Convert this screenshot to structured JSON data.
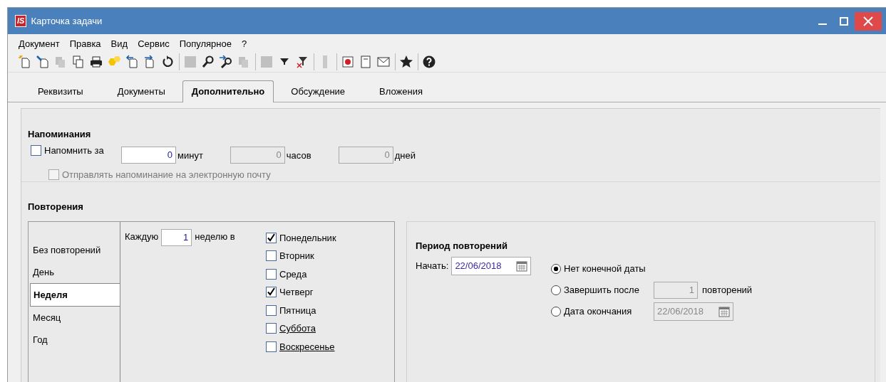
{
  "window": {
    "title": "Карточка задачи",
    "logo": "IS"
  },
  "menu": [
    "Документ",
    "Правка",
    "Вид",
    "Сервис",
    "Популярное",
    "?"
  ],
  "toolbar": [
    {
      "kind": "new",
      "disabled": false
    },
    {
      "kind": "edit",
      "disabled": false
    },
    {
      "kind": "copy",
      "disabled": true
    },
    {
      "kind": "duplicate",
      "disabled": false
    },
    {
      "kind": "print",
      "disabled": false
    },
    {
      "kind": "group",
      "disabled": false
    },
    {
      "kind": "import",
      "disabled": false
    },
    {
      "kind": "export",
      "disabled": false
    },
    {
      "kind": "refresh",
      "disabled": false
    },
    {
      "kind": "separator"
    },
    {
      "kind": "block",
      "disabled": true
    },
    {
      "kind": "search",
      "disabled": false
    },
    {
      "kind": "searchnext",
      "disabled": false
    },
    {
      "kind": "copy",
      "disabled": true
    },
    {
      "kind": "separator"
    },
    {
      "kind": "block",
      "disabled": true
    },
    {
      "kind": "filter",
      "disabled": false
    },
    {
      "kind": "filterclear",
      "disabled": false
    },
    {
      "kind": "separator"
    },
    {
      "kind": "bar",
      "disabled": true
    },
    {
      "kind": "separator"
    },
    {
      "kind": "record",
      "disabled": false
    },
    {
      "kind": "page",
      "disabled": false
    },
    {
      "kind": "mail",
      "disabled": false
    },
    {
      "kind": "separator"
    },
    {
      "kind": "star",
      "disabled": false
    },
    {
      "kind": "separator"
    },
    {
      "kind": "help",
      "disabled": false
    }
  ],
  "tabs": [
    {
      "label": "Реквизиты",
      "selected": false
    },
    {
      "label": "Документы",
      "selected": false
    },
    {
      "label": "Дополнительно",
      "selected": true
    },
    {
      "label": "Обсуждение",
      "selected": false
    },
    {
      "label": "Вложения",
      "selected": false
    }
  ],
  "reminders": {
    "heading": "Напоминания",
    "remind": {
      "label": "Напомнить за",
      "checked": false
    },
    "fields": [
      {
        "value": "0",
        "unit": "минут",
        "disabled": false
      },
      {
        "value": "0",
        "unit": "часов",
        "disabled": true
      },
      {
        "value": "0",
        "unit": "дней",
        "disabled": true
      }
    ],
    "email": {
      "label": "Отправлять напоминание на электронную почту",
      "checked": false,
      "disabled": true
    }
  },
  "repeats": {
    "heading": "Повторения",
    "modes": [
      {
        "label": "Без повторений",
        "selected": false
      },
      {
        "label": "День",
        "selected": false
      },
      {
        "label": "Неделя",
        "selected": true
      },
      {
        "label": "Месяц",
        "selected": false
      },
      {
        "label": "Год",
        "selected": false
      }
    ],
    "every_label": "Каждую",
    "every_value": "1",
    "every_suffix": "неделю в",
    "days": [
      {
        "label": "Понедельник",
        "checked": true,
        "underlined": false
      },
      {
        "label": "Вторник",
        "checked": false,
        "underlined": false
      },
      {
        "label": "Среда",
        "checked": false,
        "underlined": false
      },
      {
        "label": "Четверг",
        "checked": true,
        "underlined": false
      },
      {
        "label": "Пятница",
        "checked": false,
        "underlined": false
      },
      {
        "label": "Суббота",
        "checked": false,
        "underlined": true
      },
      {
        "label": "Воскресенье",
        "checked": false,
        "underlined": true
      }
    ],
    "period": {
      "heading": "Период повторений",
      "start_label": "Начать:",
      "start_value": "22/06/2018",
      "options": [
        {
          "kind": "none",
          "label": "Нет конечной даты",
          "selected": true
        },
        {
          "kind": "count",
          "label": "Завершить после",
          "selected": false,
          "value": "1",
          "suffix": "повторений"
        },
        {
          "kind": "date",
          "label": "Дата окончания",
          "selected": false,
          "value": "22/06/2018"
        }
      ]
    }
  }
}
